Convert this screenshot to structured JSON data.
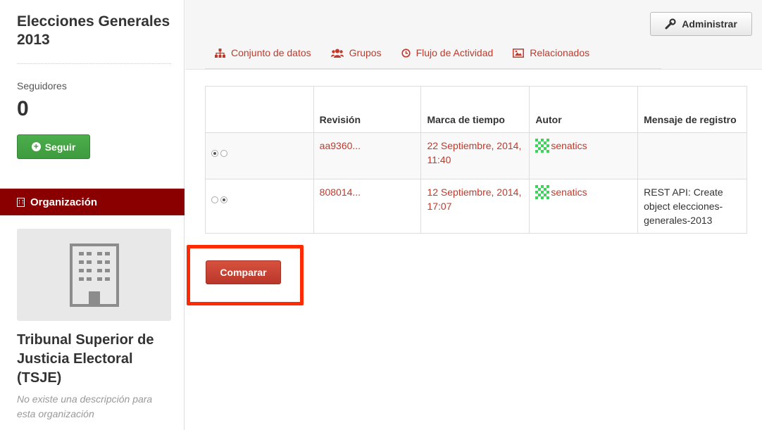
{
  "sidebar": {
    "dataset_title": "Elecciones Generales 2013",
    "followers_label": "Seguidores",
    "followers_count": "0",
    "follow_label": "Seguir",
    "org_section_label": "Organización",
    "org_name": "Tribunal Superior de Justicia Electoral (TSJE)",
    "org_description": "No existe una descripción para esta organización"
  },
  "header": {
    "admin_label": "Administrar"
  },
  "tabs": [
    {
      "label": "Conjunto de datos",
      "icon": "sitemap-icon"
    },
    {
      "label": "Grupos",
      "icon": "users-icon"
    },
    {
      "label": "Flujo de Actividad",
      "icon": "clock-icon"
    },
    {
      "label": "Relacionados",
      "icon": "picture-icon"
    }
  ],
  "table": {
    "headers": [
      "",
      "Revisión",
      "Marca de tiempo",
      "Autor",
      "Mensaje de registro"
    ],
    "rows": [
      {
        "radio_left": true,
        "radio_right": false,
        "revision": "aa9360...",
        "timestamp": "22 Septiembre, 2014, 11:40",
        "author": "senatics",
        "message": ""
      },
      {
        "radio_left": false,
        "radio_right": true,
        "revision": "808014...",
        "timestamp": "12 Septiembre, 2014, 17:07",
        "author": "senatics",
        "message": "REST API: Create object elecciones-generales-2013"
      }
    ]
  },
  "compare_label": "Comparar",
  "colors": {
    "accent": "#c0392b",
    "org_header": "#8a0000",
    "follow": "#4cae4c",
    "highlight": "#ff2a00"
  }
}
